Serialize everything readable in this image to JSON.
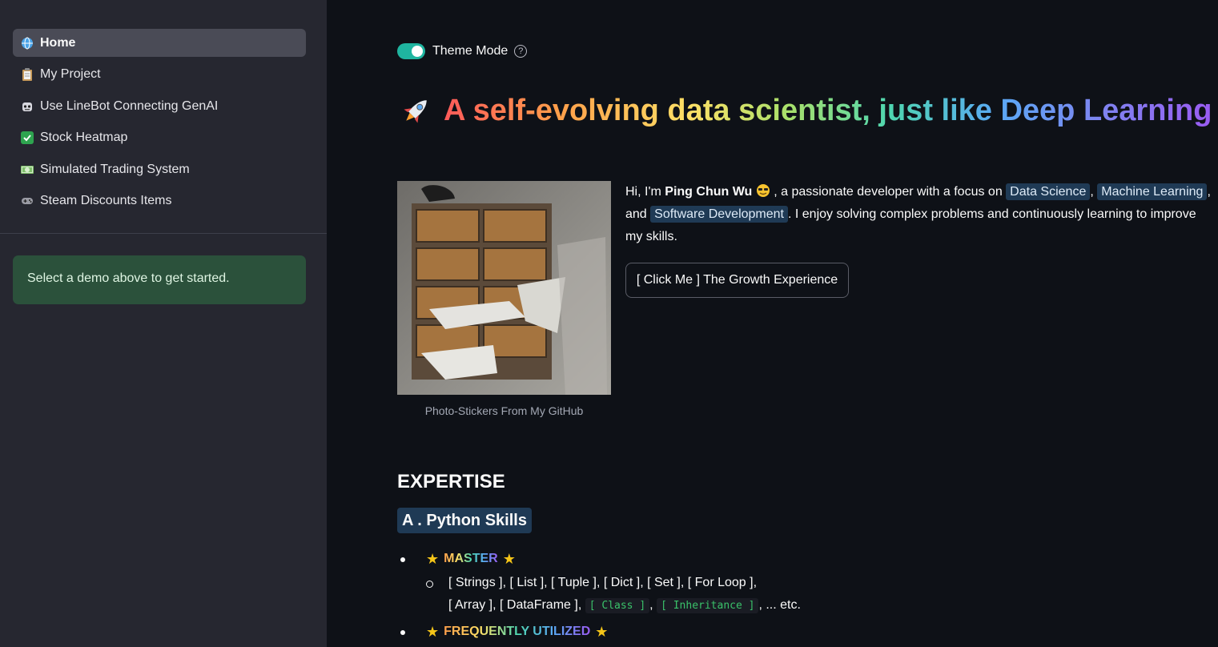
{
  "sidebar": {
    "items": [
      {
        "label": "Home",
        "icon": "globe-icon",
        "active": true
      },
      {
        "label": "My Project",
        "icon": "clipboard-icon"
      },
      {
        "label": "Use LineBot Connecting GenAI",
        "icon": "robot-icon"
      },
      {
        "label": "Stock Heatmap",
        "icon": "checkmark-icon"
      },
      {
        "label": "Simulated Trading System",
        "icon": "money-icon"
      },
      {
        "label": "Steam Discounts Items",
        "icon": "gamepad-icon"
      }
    ],
    "info_message": "Select a demo above to get started."
  },
  "header": {
    "toggle_label": "Theme Mode",
    "toggle_on": true,
    "headline": "A self-evolving data scientist, just like Deep Learning"
  },
  "profile": {
    "photo_caption": "Photo-Stickers From My GitHub",
    "intro_prefix": "Hi, I'm ",
    "name": "Ping Chun Wu",
    "intro_mid": ", a passionate developer with a focus on ",
    "chip_1": "Data Science",
    "chip_2": "Machine Learning",
    "chip_3": "Software Development",
    "intro_and": "and ",
    "intro_suffix": ". I enjoy solving complex problems and continuously learning to improve my skills.",
    "button_label": "[ Click Me ] The Growth Experience"
  },
  "expertise": {
    "title": "EXPERTISE",
    "subsection": "A . Python Skills",
    "level_1": "MASTER",
    "level_1_items_line1": "[ Strings ], [ List ], [ Tuple ], [ Dict ], [ Set ], [ For Loop ],",
    "level_1_items_line2": "[ Array ], [ DataFrame ], ",
    "code_1": "[ Class ]",
    "code_2": "[ Inheritance ]",
    "etc": ", ... etc.",
    "level_2": "FREQUENTLY UTILIZED"
  },
  "colors": {
    "sidebar_bg": "#262730",
    "main_bg": "#0e1117",
    "info_bg": "#2b513b",
    "toggle": "#1fb5a0",
    "chip_bg": "#1f3a55"
  }
}
